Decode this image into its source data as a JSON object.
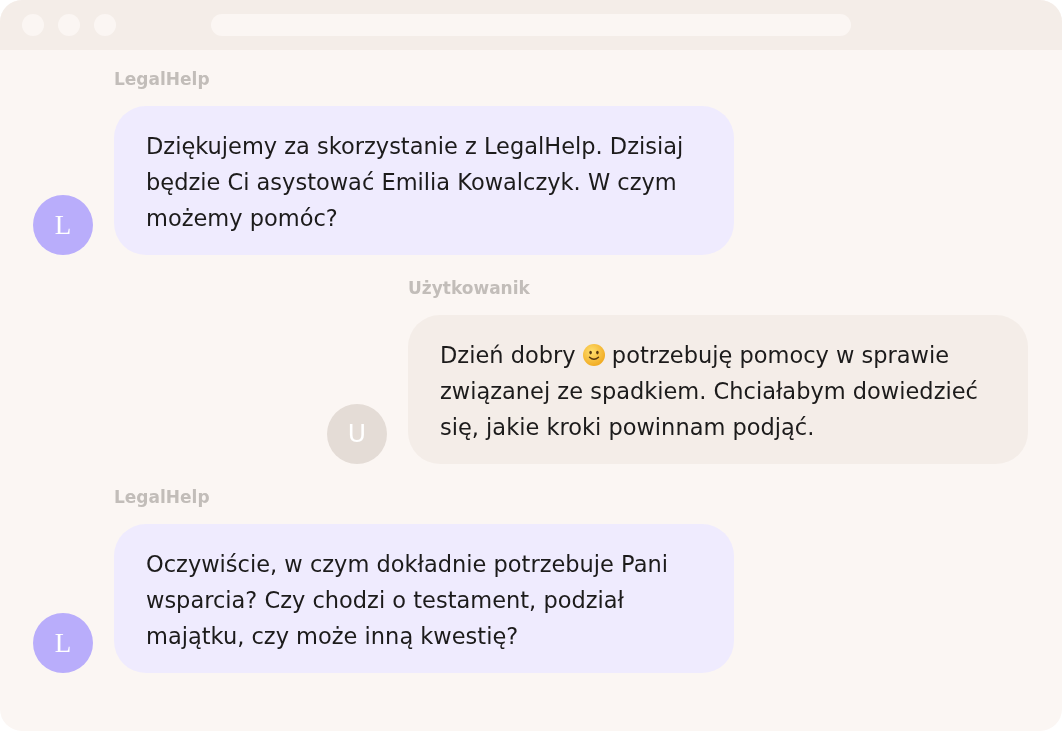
{
  "messages": [
    {
      "kind": "agent",
      "sender": "LegalHelp",
      "avatar": "L",
      "parts": [
        {
          "kind": "text",
          "text": "Dziękujemy za skorzystanie z LegalHelp. Dzisiaj będzie Ci asystować Emilia Kowalczyk. W czym możemy pomóc?"
        }
      ]
    },
    {
      "kind": "user",
      "sender": "Użytkowanik",
      "avatar": "U",
      "parts": [
        {
          "kind": "text",
          "text": "Dzień dobry"
        },
        {
          "kind": "emoji"
        },
        {
          "kind": "text",
          "text": "potrzebuję pomocy w sprawie związanej ze spadkiem. Chciałabym dowiedzieć się, jakie kroki powinnam podjąć."
        }
      ]
    },
    {
      "kind": "agent",
      "sender": "LegalHelp",
      "avatar": "L",
      "parts": [
        {
          "kind": "text",
          "text": "Oczywiście, w czym dokładnie potrzebuje Pani wsparcia? Czy chodzi o testament, podział majątku, czy może inną kwestię?"
        }
      ]
    }
  ]
}
